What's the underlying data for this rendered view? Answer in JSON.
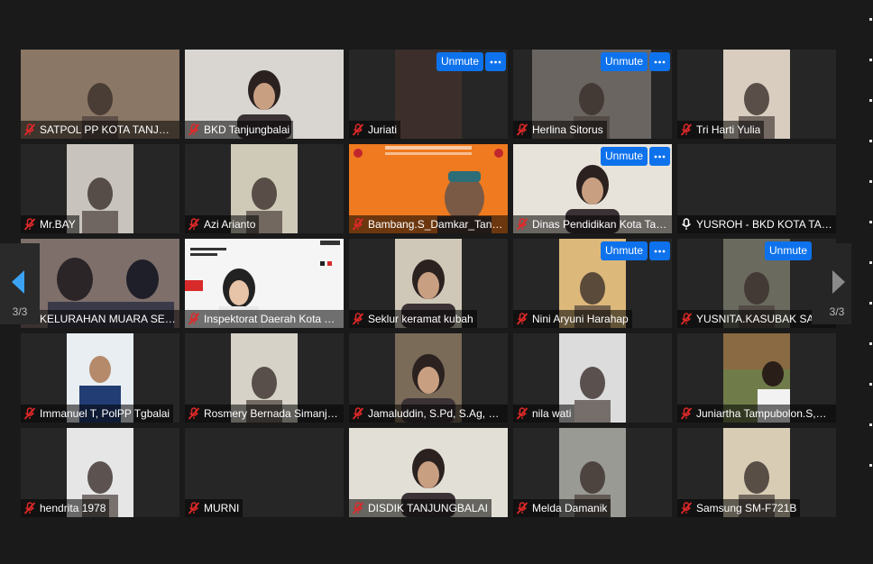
{
  "navigation": {
    "prev_page_indicator": "3/3",
    "next_page_indicator": "3/3"
  },
  "controls": {
    "unmute_label": "Unmute",
    "more_icon": "more-horizontal-icon"
  },
  "colors": {
    "background": "#1a1a1a",
    "tile_background": "#262626",
    "unmute_button": "#0e72ed",
    "muted_mic": "#e02828"
  },
  "participants": [
    {
      "name": "SATPOL PP KOTA TANJUNGBALAI",
      "muted": true
    },
    {
      "name": "BKD Tanjungbalai",
      "muted": true
    },
    {
      "name": "Juriati",
      "muted": true,
      "unmute_button": true
    },
    {
      "name": "Herlina Sitorus",
      "muted": true,
      "unmute_button": true
    },
    {
      "name": "Tri Harti Yulia",
      "muted": true
    },
    {
      "name": "Mr.BAY",
      "muted": true
    },
    {
      "name": "Azi Arianto",
      "muted": true
    },
    {
      "name": "Bambang.S_Damkar_Tanjungbalai",
      "muted": true
    },
    {
      "name": "Dinas Pendidikan Kota Tanjungbalai",
      "muted": true,
      "unmute_button": true
    },
    {
      "name": "YUSROH - BKD KOTA TANJUNGBALAI",
      "muted": false
    },
    {
      "name": "KELURAHAN MUARA SENTOSA",
      "muted": true
    },
    {
      "name": "Inspektorat Daerah Kota Tanjungbalai",
      "muted": true
    },
    {
      "name": "Seklur keramat kubah",
      "muted": true
    },
    {
      "name": "Nini Aryuni Harahap",
      "muted": true,
      "unmute_button": true
    },
    {
      "name": "YUSNITA.KASUBAK SATPOL PP",
      "muted": true,
      "unmute_button": true
    },
    {
      "name": "Immanuel T, PolPP Tgbalai",
      "muted": true
    },
    {
      "name": "Rosmery Bernada Simanjuntak",
      "muted": true
    },
    {
      "name": "Jamaluddin, S.Pd, S.Ag, M.Pd",
      "muted": true
    },
    {
      "name": "nila wati",
      "muted": true
    },
    {
      "name": "Juniartha Tampubolon.S,Sos",
      "muted": true
    },
    {
      "name": "hendrita 1978",
      "muted": true
    },
    {
      "name": "MURNI",
      "muted": true
    },
    {
      "name": "DISDIK TANJUNGBALAI",
      "muted": true
    },
    {
      "name": "Melda Damanik",
      "muted": true
    },
    {
      "name": "Samsung SM-F721B",
      "muted": true
    }
  ]
}
